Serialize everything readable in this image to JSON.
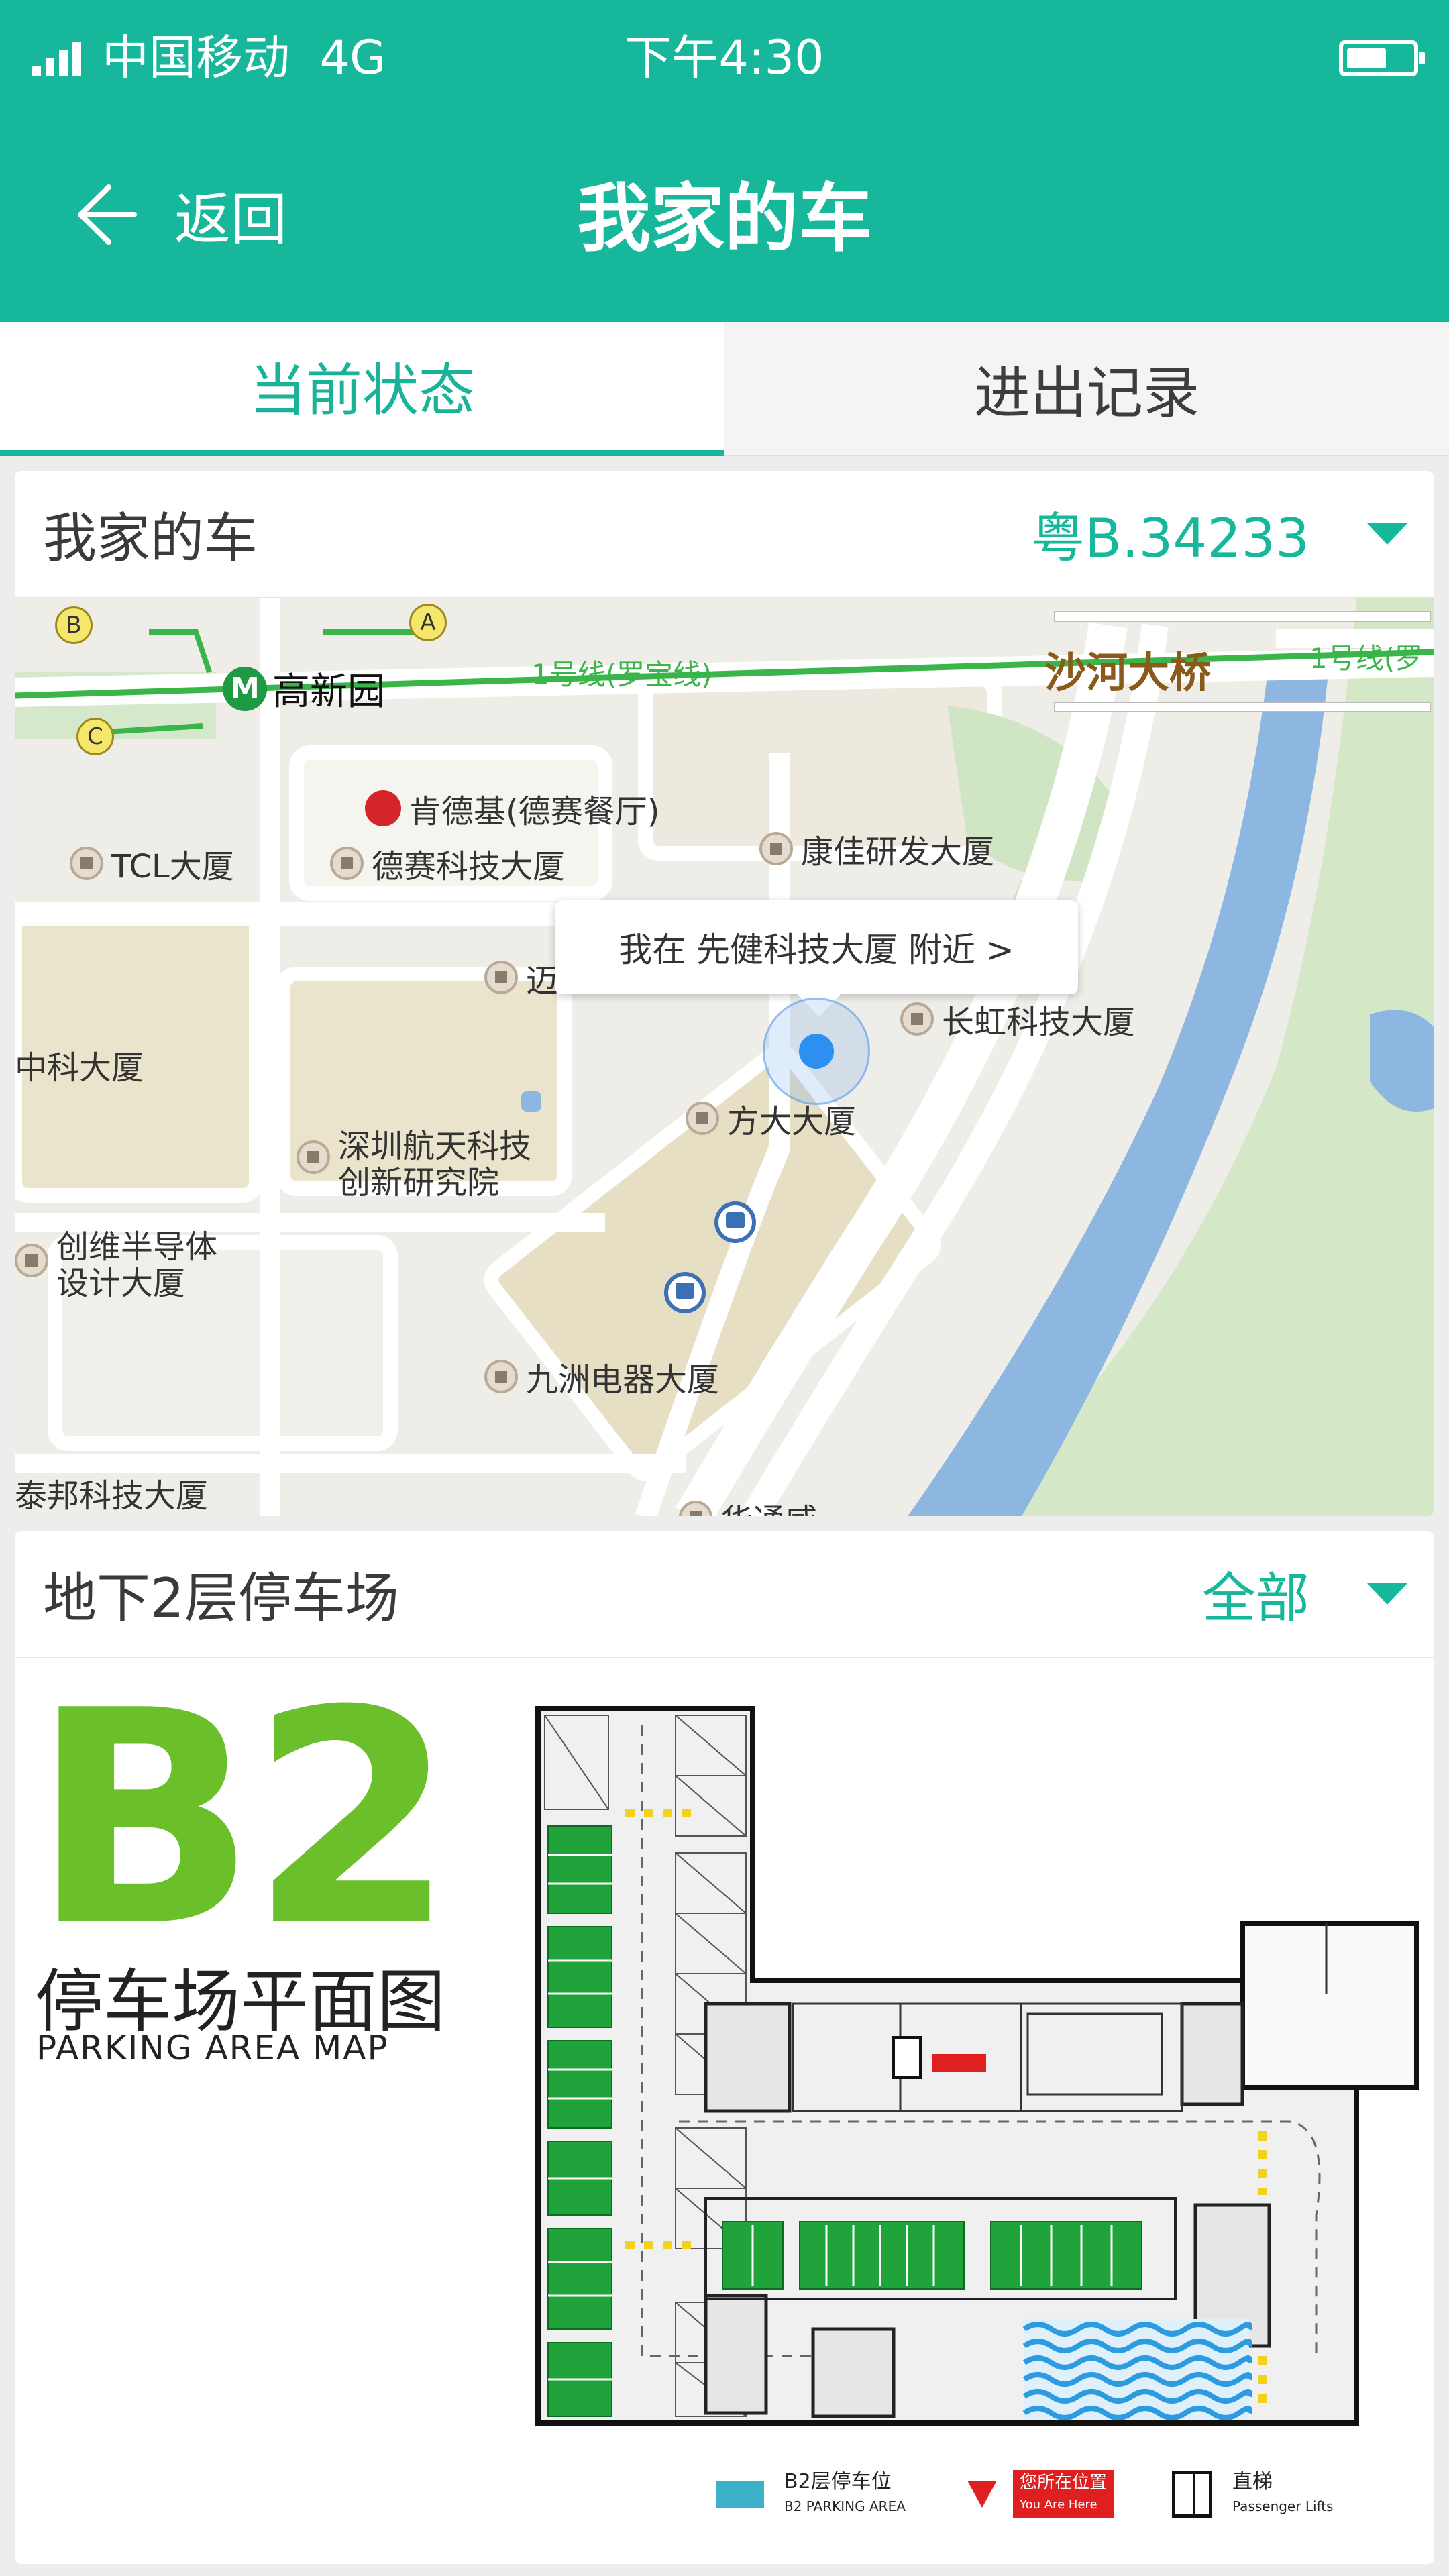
{
  "status_bar": {
    "carrier": "中国移动",
    "network": "4G",
    "time": "下午4:30"
  },
  "nav": {
    "back_label": "返回",
    "title": "我家的车"
  },
  "tabs": [
    {
      "label": "当前状态",
      "active": true
    },
    {
      "label": "进出记录",
      "active": false
    }
  ],
  "car_card": {
    "label": "我家的车",
    "plate": "粤B.34233"
  },
  "map": {
    "metro_station": "高新园",
    "metro_line": "1号线(罗宝线)",
    "metro_line_partial": "1号线(罗",
    "bridge": "沙河大桥",
    "exits": [
      "A",
      "B",
      "C"
    ],
    "location_bubble": "我在 先健科技大厦 附近 >",
    "pois": {
      "kfc": "肯德基(德赛餐厅)",
      "tcl": "TCL大厦",
      "desai": "德赛科技大厦",
      "kangjia": "康佳研发大厦",
      "mai": "迈",
      "changhong": "长虹科技大厦",
      "zhongke": "中科大厦",
      "fangda": "方大大厦",
      "aerospace": "深圳航天科技\n创新研究院",
      "chuangwei": "创维半导体\n设计大厦",
      "jiuzhou": "九洲电器大厦",
      "taibang": "泰邦科技大厦",
      "huatong": "华通威"
    }
  },
  "parking_card": {
    "label": "地下2层停车场",
    "filter": "全部",
    "floor_code": "B2",
    "plan_title": "停车场平面图",
    "plan_subtitle": "PARKING AREA MAP",
    "legend": {
      "parking": {
        "cn": "B2层停车位",
        "en": "B2 PARKING AREA"
      },
      "you_are_here": {
        "cn": "您所在位置",
        "en": "You Are Here"
      },
      "lift": {
        "cn": "直梯",
        "en": "Passenger Lifts"
      }
    }
  },
  "colors": {
    "brand": "#16b79a",
    "metro_green": "#3ab54a",
    "parking_green": "#1fa33a",
    "river": "#8db7e0"
  }
}
